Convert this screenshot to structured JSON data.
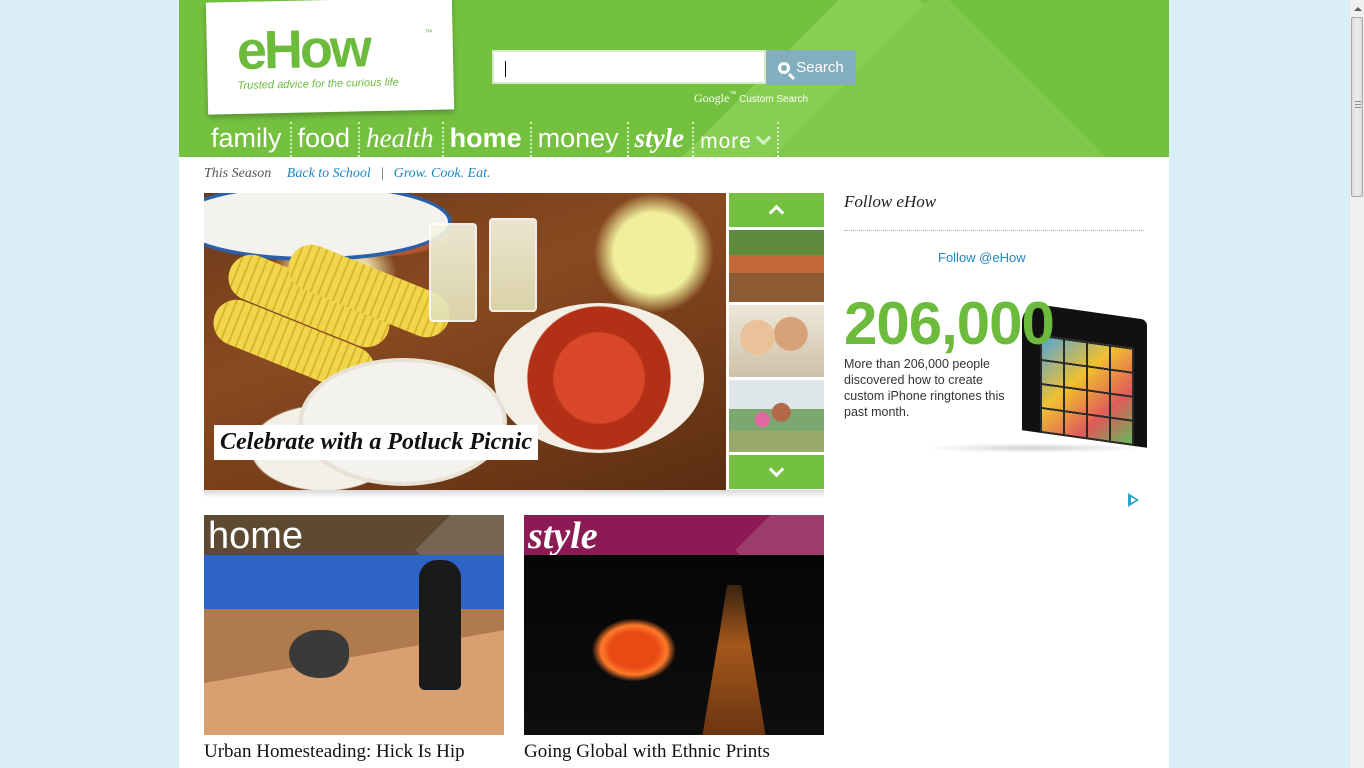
{
  "header": {
    "logo_text": "eHow",
    "logo_tm": "™",
    "tagline": "Trusted advice for the curious life",
    "search": {
      "value": "",
      "button_label": "Search"
    },
    "google_text": "Google",
    "google_tm": "™",
    "custom_search_text": "Custom Search"
  },
  "nav": {
    "items": [
      {
        "label": "family"
      },
      {
        "label": "food"
      },
      {
        "label": "health"
      },
      {
        "label": "home"
      },
      {
        "label": "money"
      },
      {
        "label": "style"
      },
      {
        "label": "more"
      }
    ]
  },
  "season": {
    "label": "This Season",
    "links": [
      "Back to School",
      "Grow. Cook. Eat."
    ],
    "separator": "|"
  },
  "hero": {
    "caption": "Celebrate with a Potluck Picnic"
  },
  "categories": [
    {
      "title": "home",
      "headline": "Urban Homesteading: Hick Is Hip",
      "color": "#5e4a33"
    },
    {
      "title": "style",
      "headline": "Going Global with Ethnic Prints",
      "color": "#8c1a55"
    }
  ],
  "sidebar": {
    "follow_title": "Follow eHow",
    "follow_link": "Follow @eHow",
    "ad": {
      "big_number": "206,000",
      "description": "More than 206,000 people discovered how to create custom iPhone ringtones this past month."
    }
  },
  "colors": {
    "brand_green": "#74c140",
    "link_blue": "#1f86c4",
    "page_background": "#d9eef7"
  }
}
